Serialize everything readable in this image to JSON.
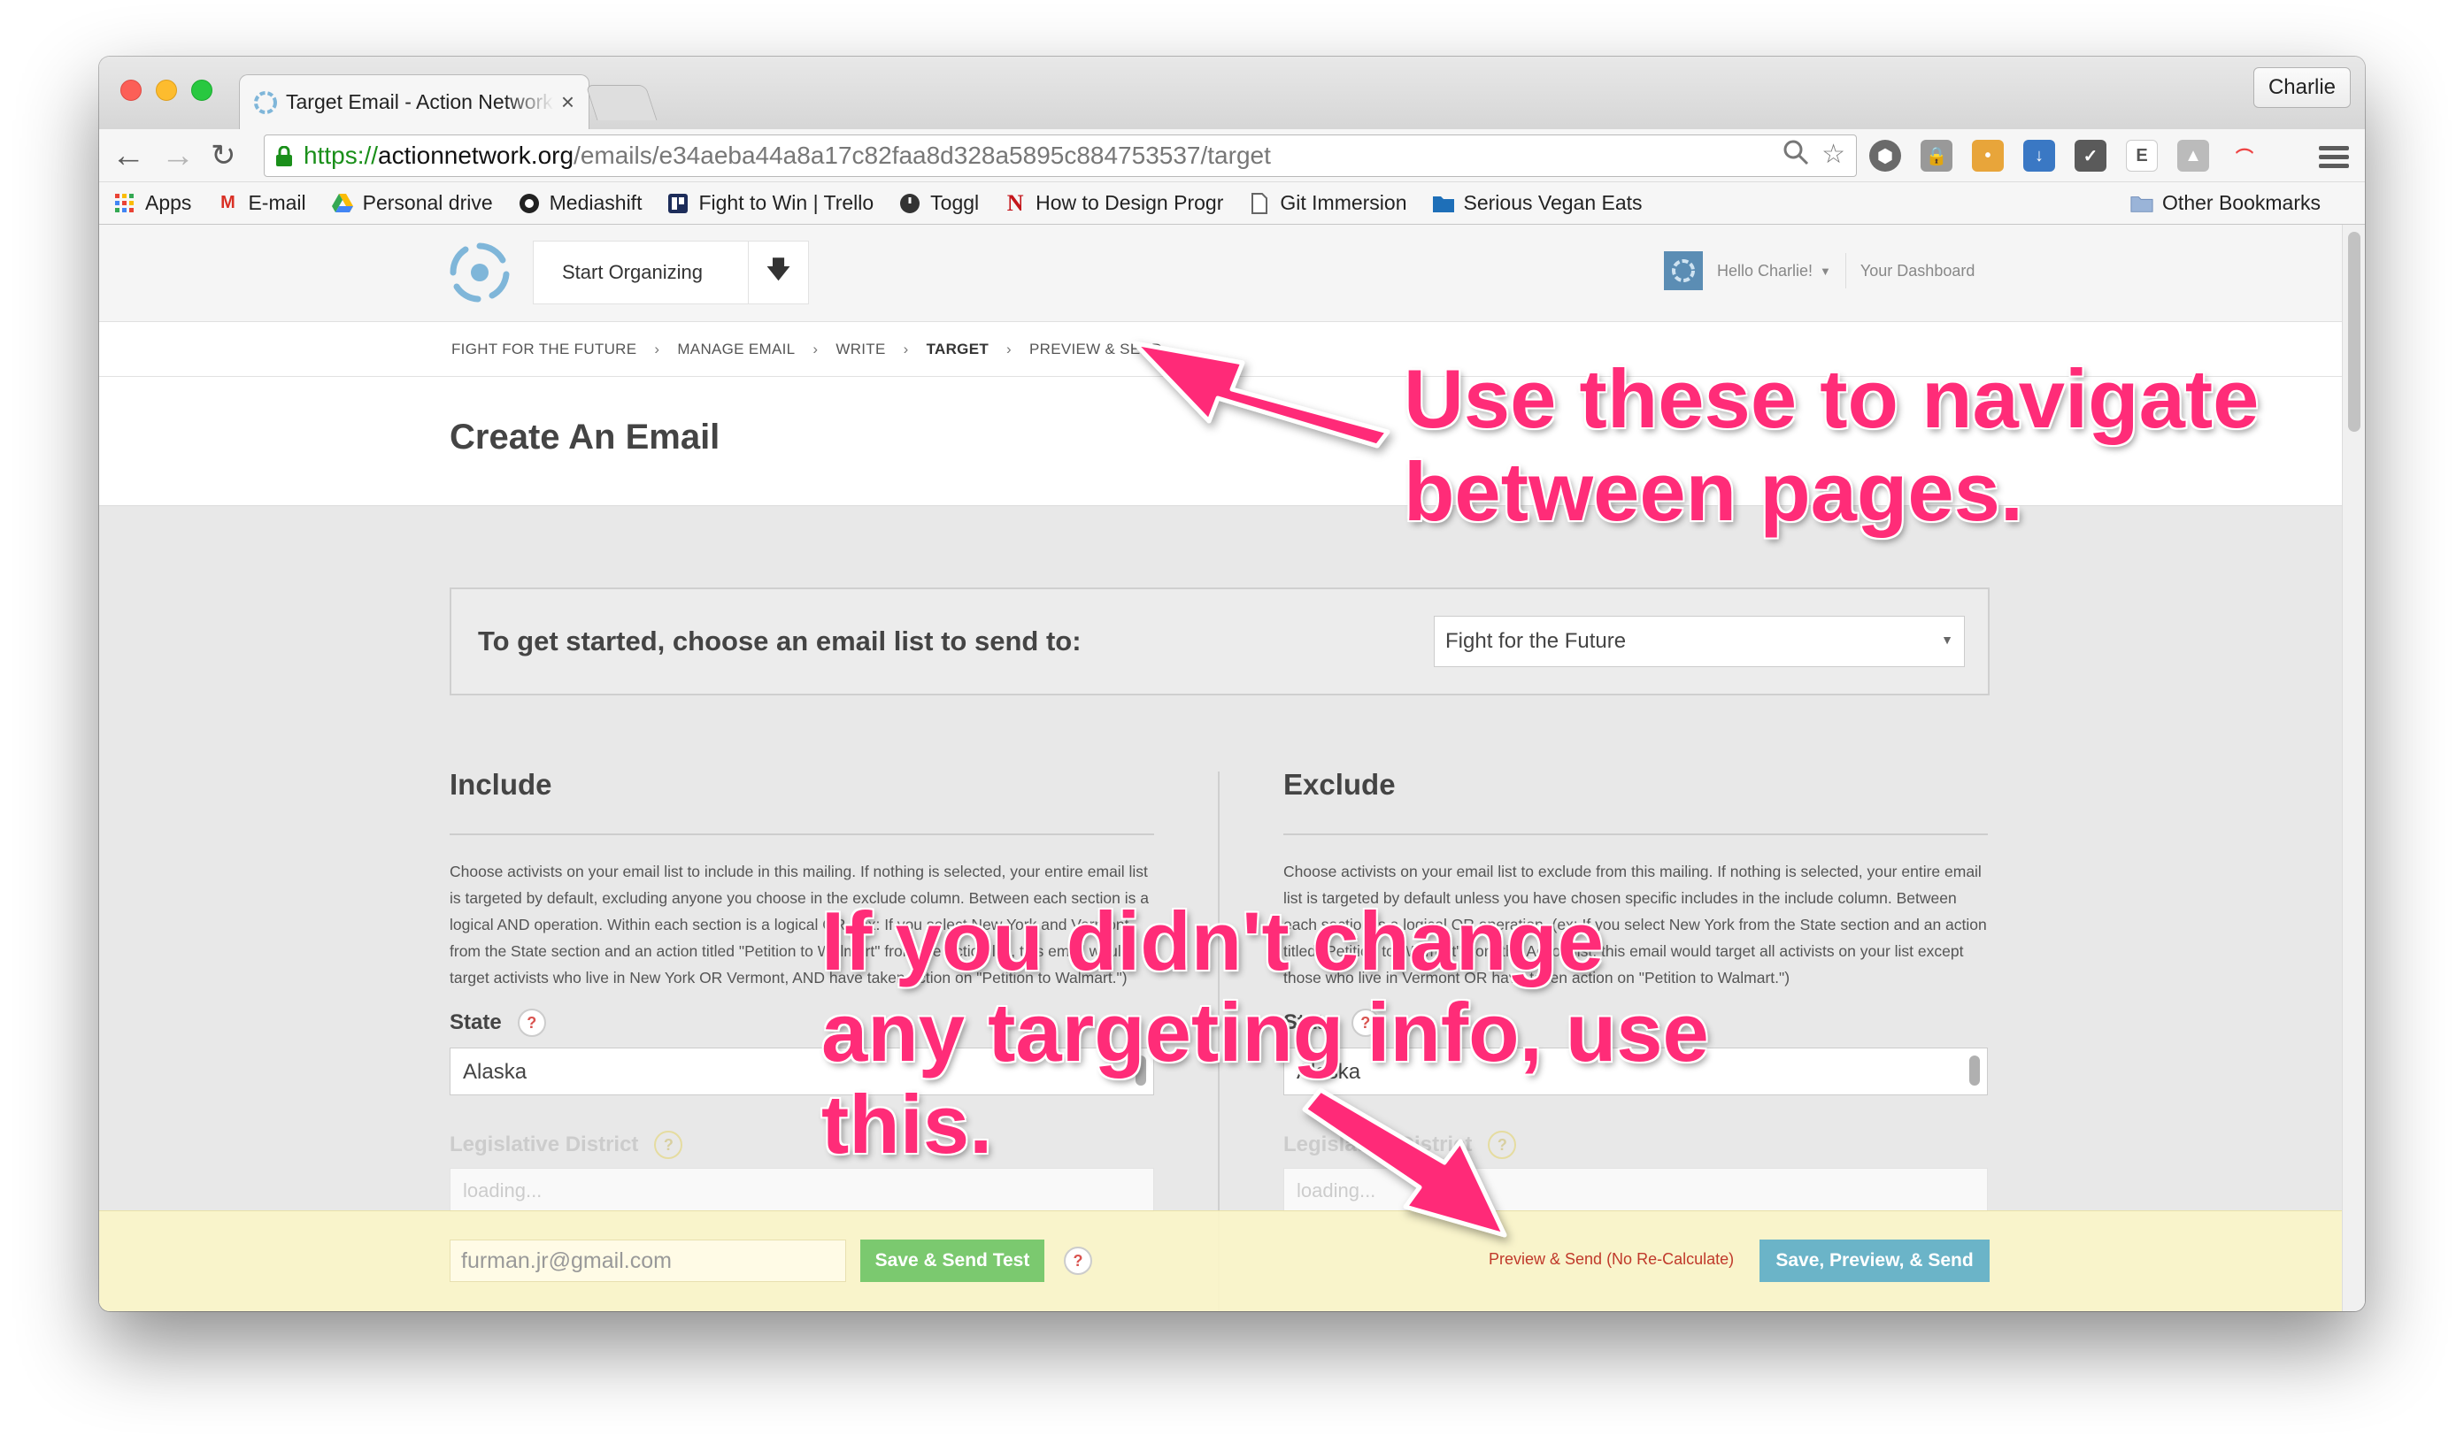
{
  "browser": {
    "tab_title": "Target Email - Action Network",
    "profile_name": "Charlie",
    "url": {
      "scheme": "https://",
      "host": "actionnetwork.org",
      "path": "/emails/e34aeba44a8a17c82faa8d328a5895c884753537/target"
    },
    "bookmarks": [
      {
        "label": "Apps",
        "icon": "apps-grid-icon"
      },
      {
        "label": "E-mail",
        "icon": "gmail-icon"
      },
      {
        "label": "Personal drive",
        "icon": "drive-icon"
      },
      {
        "label": "Mediashift",
        "icon": "mediashift-icon"
      },
      {
        "label": "Fight to Win | Trello",
        "icon": "trello-icon"
      },
      {
        "label": "Toggl",
        "icon": "toggl-icon"
      },
      {
        "label": "How to Design Progr",
        "icon": "n-icon"
      },
      {
        "label": "Git Immersion",
        "icon": "page-icon"
      },
      {
        "label": "Serious Vegan Eats",
        "icon": "folder-icon"
      }
    ],
    "other_bookmarks": "Other Bookmarks"
  },
  "site": {
    "start_organizing": "Start Organizing",
    "greeting": "Hello Charlie!",
    "dashboard": "Your Dashboard",
    "breadcrumbs": [
      "FIGHT FOR THE FUTURE",
      "MANAGE EMAIL",
      "WRITE",
      "TARGET",
      "PREVIEW & SEND"
    ],
    "page_title": "Create An Email",
    "list_prompt": "To get started, choose an email list to send to:",
    "list_selected": "Fight for the Future"
  },
  "include": {
    "heading": "Include",
    "description": "Choose activists on your email list to include in this mailing. If nothing is selected, your entire email list is targeted by default, excluding anyone you choose in the exclude column. Between each section is a logical AND operation. Within each section is a logical OR. (ex: If you select New York and Vermont from the State section and an action titled \"Petition to Walmart\" from the Action list, this email would target activists who live in New York OR Vermont, AND have taken action on \"Petition to Walmart.\")",
    "state_label": "State",
    "state_value": "Alaska",
    "district_label": "Legislative District",
    "district_value": "loading..."
  },
  "exclude": {
    "heading": "Exclude",
    "description": "Choose activists on your email list to exclude from this mailing. If nothing is selected, your entire email list is targeted by default unless you have chosen specific includes in the include column. Between each section is a logical OR operation. (ex: If you select New York from the State section and an action titled \"Petition to Walmart\" from the Action list, this email would target all activists on your list except those who live in Vermont OR have taken action on \"Petition to Walmart.\")",
    "state_label": "State",
    "state_value": "Alaska",
    "district_label": "Legislative District",
    "district_value": "loading..."
  },
  "footer": {
    "test_email": "furman.jr@gmail.com",
    "save_send_test": "Save & Send Test",
    "preview_no_recalc": "Preview & Send (No Re-Calculate)",
    "save_preview_send": "Save, Preview, & Send"
  },
  "annotations": {
    "nav_note": [
      "Use these to navigate",
      "between pages."
    ],
    "targeting_note": [
      "If you didn't change",
      "any targeting info, use",
      "this."
    ]
  },
  "colors": {
    "annotation": "#ff2c78",
    "accent_blue": "#6bb4c8",
    "accent_green": "#7bc96f",
    "footer_bg": "#faf4c8"
  }
}
